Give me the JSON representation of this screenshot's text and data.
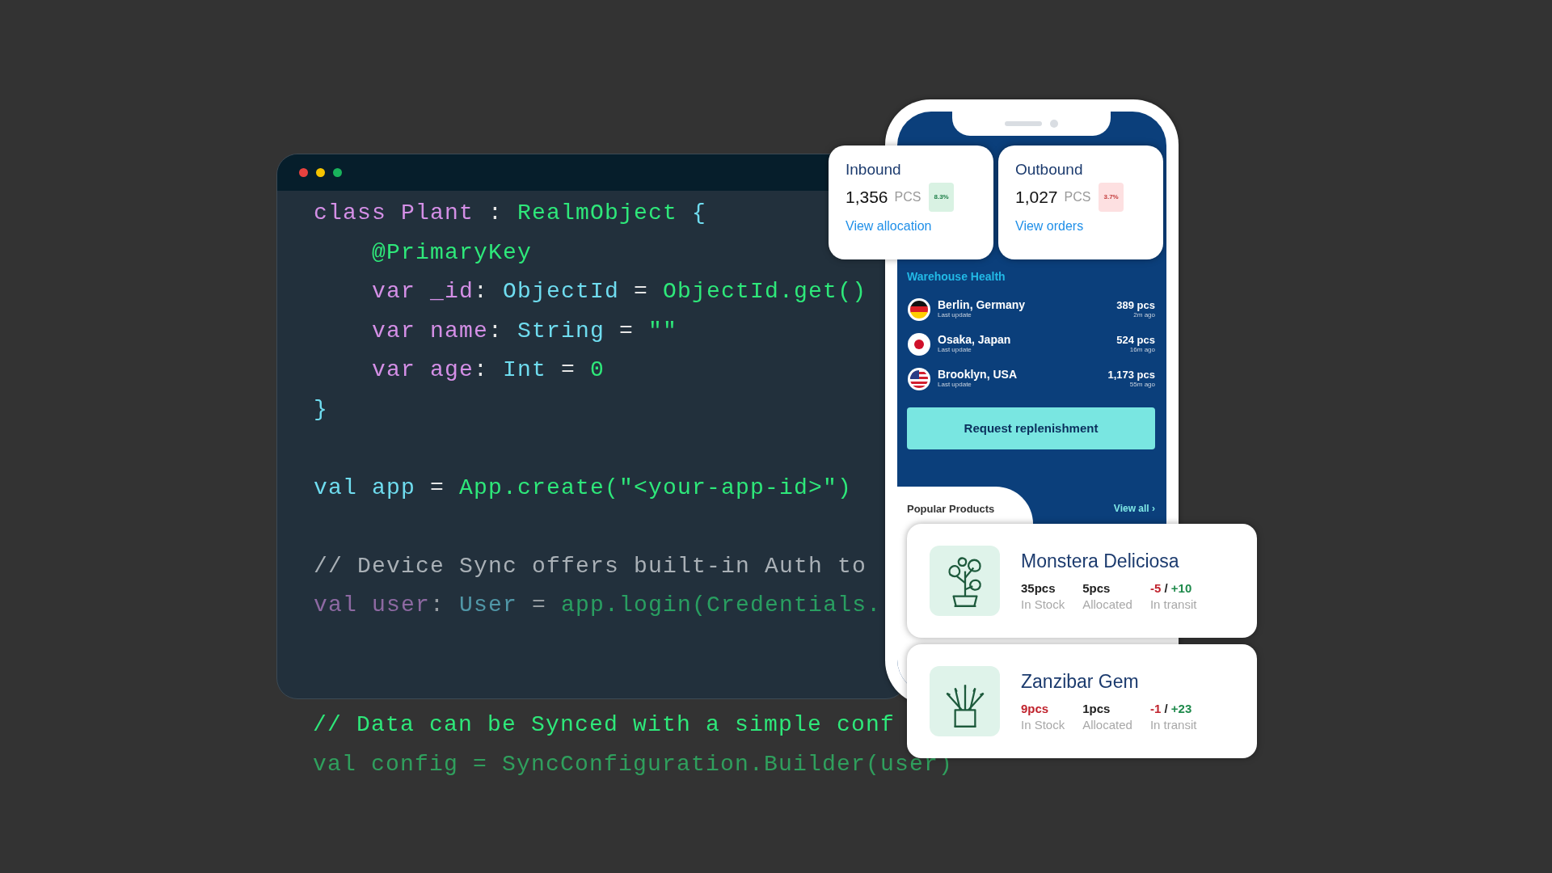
{
  "code_window": {
    "window_buttons": [
      {
        "color": "#e8423f"
      },
      {
        "color": "#f5c400"
      },
      {
        "color": "#19b35c"
      }
    ],
    "lines": [
      {
        "faded": false,
        "gap_before": false,
        "tokens": [
          {
            "text": "class ",
            "kind": "keyword"
          },
          {
            "text": "Plant",
            "kind": "keyword"
          },
          {
            "text": " : ",
            "kind": "plain"
          },
          {
            "text": "RealmObject",
            "kind": "call"
          },
          {
            "text": " {",
            "kind": "type"
          }
        ]
      },
      {
        "faded": false,
        "gap_before": false,
        "tokens": [
          {
            "text": "    @PrimaryKey",
            "kind": "call"
          }
        ]
      },
      {
        "faded": false,
        "gap_before": false,
        "tokens": [
          {
            "text": "    var _id",
            "kind": "keyword"
          },
          {
            "text": ": ",
            "kind": "plain"
          },
          {
            "text": "ObjectId",
            "kind": "type"
          },
          {
            "text": " = ",
            "kind": "plain"
          },
          {
            "text": "ObjectId.get()",
            "kind": "call"
          }
        ]
      },
      {
        "faded": false,
        "gap_before": false,
        "tokens": [
          {
            "text": "    var name",
            "kind": "keyword"
          },
          {
            "text": ": ",
            "kind": "plain"
          },
          {
            "text": "String",
            "kind": "type"
          },
          {
            "text": " = ",
            "kind": "plain"
          },
          {
            "text": "\"\"",
            "kind": "call"
          }
        ]
      },
      {
        "faded": false,
        "gap_before": false,
        "tokens": [
          {
            "text": "    var age",
            "kind": "keyword"
          },
          {
            "text": ": ",
            "kind": "plain"
          },
          {
            "text": "Int",
            "kind": "type"
          },
          {
            "text": " = ",
            "kind": "plain"
          },
          {
            "text": "0",
            "kind": "call"
          }
        ]
      },
      {
        "faded": false,
        "gap_before": false,
        "tokens": [
          {
            "text": "}",
            "kind": "type"
          }
        ]
      },
      {
        "faded": false,
        "gap_before": true,
        "tokens": [
          {
            "text": "val app",
            "kind": "type"
          },
          {
            "text": " = ",
            "kind": "plain"
          },
          {
            "text": "App.create(\"<your-app-id>\")",
            "kind": "call"
          }
        ]
      },
      {
        "faded": false,
        "gap_before": true,
        "tokens": [
          {
            "text": "// Device Sync offers built-in Auth to",
            "kind": "comment"
          }
        ]
      },
      {
        "faded": true,
        "gap_before": false,
        "tokens": [
          {
            "text": "val user",
            "kind": "keyword"
          },
          {
            "text": ": ",
            "kind": "plain"
          },
          {
            "text": "User",
            "kind": "type"
          },
          {
            "text": " = ",
            "kind": "plain"
          },
          {
            "text": "app.login(Credentials.",
            "kind": "call"
          }
        ]
      }
    ]
  },
  "code_below": [
    {
      "faded": false,
      "gap_before": false,
      "tokens": [
        {
          "text": "// Data can be Synced with a simple conf",
          "kind": "call"
        }
      ]
    },
    {
      "faded": true,
      "gap_before": false,
      "tokens": [
        {
          "text": "val config = SyncConfiguration.Builder(user)",
          "kind": "call"
        }
      ]
    }
  ],
  "phone": {
    "summary_cards": [
      {
        "title": "Inbound",
        "count": "1,356",
        "unit": "PCS",
        "change": "8.3%",
        "positive": true,
        "link": "View allocation"
      },
      {
        "title": "Outbound",
        "count": "1,027",
        "unit": "PCS",
        "change": "3.7%",
        "positive": false,
        "link": "View orders"
      }
    ],
    "warehouse_health": {
      "title": "Warehouse Health",
      "rows": [
        {
          "place": "Berlin, Germany",
          "caption": "Last update",
          "count": "389 pcs",
          "ago": "2m ago"
        },
        {
          "place": "Osaka, Japan",
          "caption": "Last update",
          "count": "524 pcs",
          "ago": "16m ago"
        },
        {
          "place": "Brooklyn, USA",
          "caption": "Last update",
          "count": "1,173 pcs",
          "ago": "55m ago"
        }
      ]
    },
    "action_button": "Request replenishment",
    "popular": {
      "title": "Popular Products",
      "link": "View all ›"
    },
    "products": [
      {
        "name": "Monstera Deliciosa",
        "stats": [
          {
            "label": "In Stock",
            "parts": [
              {
                "text": "35pcs",
                "color": "#222222"
              }
            ]
          },
          {
            "label": "Allocated",
            "parts": [
              {
                "text": "5pcs",
                "color": "#222222"
              }
            ]
          },
          {
            "label": "In transit",
            "parts": [
              {
                "text": "-5",
                "color": "#c0232d"
              },
              {
                "text": " / ",
                "color": "#222222"
              },
              {
                "text": "+10",
                "color": "#1f8a4c"
              }
            ]
          }
        ]
      },
      {
        "name": "Zanzibar Gem",
        "stats": [
          {
            "label": "In Stock",
            "parts": [
              {
                "text": "9pcs",
                "color": "#c0232d"
              }
            ]
          },
          {
            "label": "Allocated",
            "parts": [
              {
                "text": "1pcs",
                "color": "#222222"
              }
            ]
          },
          {
            "label": "In transit",
            "parts": [
              {
                "text": "-1",
                "color": "#c0232d"
              },
              {
                "text": " / ",
                "color": "#222222"
              },
              {
                "text": "+23",
                "color": "#1f8a4c"
              }
            ]
          }
        ]
      }
    ]
  }
}
